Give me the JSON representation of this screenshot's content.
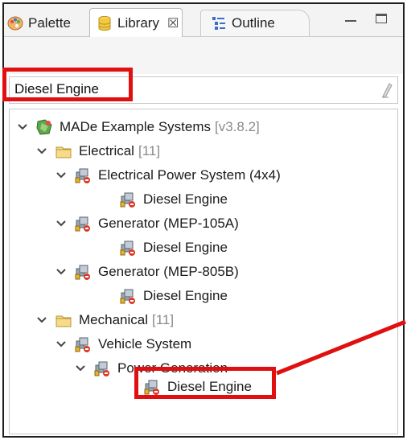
{
  "tabs": {
    "palette": "Palette",
    "library": "Library",
    "library_close": "☒",
    "outline": "Outline"
  },
  "search": {
    "value": "Diesel Engine"
  },
  "tree": {
    "root": {
      "label": "MADe Example Systems",
      "version": "[v3.8.2]"
    },
    "electrical": {
      "label": "Electrical",
      "count": "[11]"
    },
    "eps": {
      "label": "Electrical Power System (4x4)"
    },
    "eps_child": {
      "label": "Diesel Engine"
    },
    "gen105": {
      "label": "Generator (MEP-105A)"
    },
    "gen105_child": {
      "label": "Diesel Engine"
    },
    "gen805": {
      "label": "Generator (MEP-805B)"
    },
    "gen805_child": {
      "label": "Diesel Engine"
    },
    "mechanical": {
      "label": "Mechanical",
      "count": "[11]"
    },
    "vehicle": {
      "label": "Vehicle System"
    },
    "powergen": {
      "label": "Power Generation"
    },
    "powergen_child": {
      "label": "Diesel Engine"
    }
  },
  "colors": {
    "highlight": "#e01010",
    "folder": "#f3d27a",
    "system": "#4a9a3a"
  }
}
